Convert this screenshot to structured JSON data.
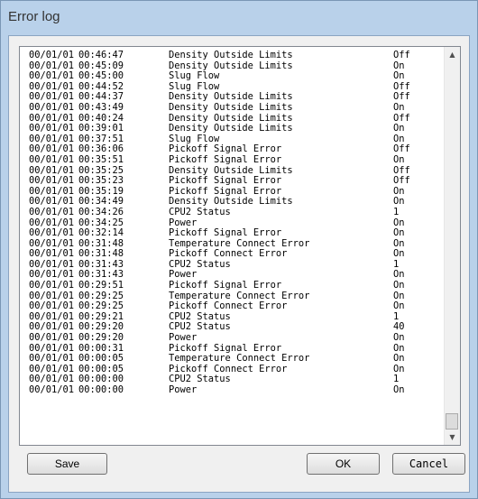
{
  "window": {
    "title": "Error log"
  },
  "log": {
    "rows": [
      {
        "date": "00/01/01",
        "time": "00:46:47",
        "message": "Density Outside Limits",
        "state": "Off"
      },
      {
        "date": "00/01/01",
        "time": "00:45:09",
        "message": "Density Outside Limits",
        "state": "On"
      },
      {
        "date": "00/01/01",
        "time": "00:45:00",
        "message": "Slug Flow",
        "state": "On"
      },
      {
        "date": "00/01/01",
        "time": "00:44:52",
        "message": "Slug Flow",
        "state": "Off"
      },
      {
        "date": "00/01/01",
        "time": "00:44:37",
        "message": "Density Outside Limits",
        "state": "Off"
      },
      {
        "date": "00/01/01",
        "time": "00:43:49",
        "message": "Density Outside Limits",
        "state": "On"
      },
      {
        "date": "00/01/01",
        "time": "00:40:24",
        "message": "Density Outside Limits",
        "state": "Off"
      },
      {
        "date": "00/01/01",
        "time": "00:39:01",
        "message": "Density Outside Limits",
        "state": "On"
      },
      {
        "date": "00/01/01",
        "time": "00:37:51",
        "message": "Slug Flow",
        "state": "On"
      },
      {
        "date": "00/01/01",
        "time": "00:36:06",
        "message": "Pickoff Signal Error",
        "state": "Off"
      },
      {
        "date": "00/01/01",
        "time": "00:35:51",
        "message": "Pickoff Signal Error",
        "state": "On"
      },
      {
        "date": "00/01/01",
        "time": "00:35:25",
        "message": "Density Outside Limits",
        "state": "Off"
      },
      {
        "date": "00/01/01",
        "time": "00:35:23",
        "message": "Pickoff Signal Error",
        "state": "Off"
      },
      {
        "date": "00/01/01",
        "time": "00:35:19",
        "message": "Pickoff Signal Error",
        "state": "On"
      },
      {
        "date": "00/01/01",
        "time": "00:34:49",
        "message": "Density Outside Limits",
        "state": "On"
      },
      {
        "date": "00/01/01",
        "time": "00:34:26",
        "message": "CPU2 Status",
        "state": "1"
      },
      {
        "date": "00/01/01",
        "time": "00:34:25",
        "message": "Power",
        "state": "On"
      },
      {
        "date": "00/01/01",
        "time": "00:32:14",
        "message": "Pickoff Signal Error",
        "state": "On"
      },
      {
        "date": "00/01/01",
        "time": "00:31:48",
        "message": "Temperature Connect Error",
        "state": "On"
      },
      {
        "date": "00/01/01",
        "time": "00:31:48",
        "message": "Pickoff Connect Error",
        "state": "On"
      },
      {
        "date": "00/01/01",
        "time": "00:31:43",
        "message": "CPU2 Status",
        "state": "1"
      },
      {
        "date": "00/01/01",
        "time": "00:31:43",
        "message": "Power",
        "state": "On"
      },
      {
        "date": "00/01/01",
        "time": "00:29:51",
        "message": "Pickoff Signal Error",
        "state": "On"
      },
      {
        "date": "00/01/01",
        "time": "00:29:25",
        "message": "Temperature Connect Error",
        "state": "On"
      },
      {
        "date": "00/01/01",
        "time": "00:29:25",
        "message": "Pickoff Connect Error",
        "state": "On"
      },
      {
        "date": "00/01/01",
        "time": "00:29:21",
        "message": "CPU2 Status",
        "state": "1"
      },
      {
        "date": "00/01/01",
        "time": "00:29:20",
        "message": "CPU2 Status",
        "state": "40"
      },
      {
        "date": "00/01/01",
        "time": "00:29:20",
        "message": "Power",
        "state": "On"
      },
      {
        "date": "00/01/01",
        "time": "00:00:31",
        "message": "Pickoff Signal Error",
        "state": "On"
      },
      {
        "date": "00/01/01",
        "time": "00:00:05",
        "message": "Temperature Connect Error",
        "state": "On"
      },
      {
        "date": "00/01/01",
        "time": "00:00:05",
        "message": "Pickoff Connect Error",
        "state": "On"
      },
      {
        "date": "00/01/01",
        "time": "00:00:00",
        "message": "CPU2 Status",
        "state": "1"
      },
      {
        "date": "00/01/01",
        "time": "00:00:00",
        "message": "Power",
        "state": "On"
      }
    ]
  },
  "scrollbar": {
    "up_icon": "▲",
    "down_icon": "▼",
    "position": 1.0
  },
  "buttons": {
    "save_label": "Save",
    "ok_label": "OK",
    "cancel_label": "Cancel"
  }
}
